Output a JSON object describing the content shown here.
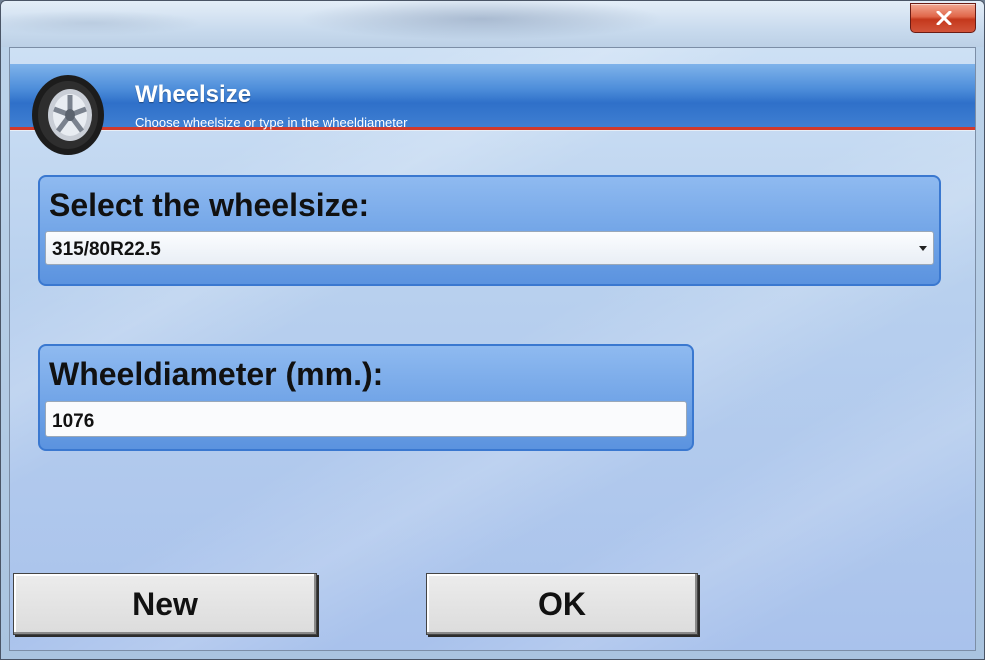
{
  "window": {
    "close_label": "x"
  },
  "header": {
    "title": "Wheelsize",
    "subtitle": "Choose wheelsize or type in the wheeldiameter",
    "icon": "tire-icon",
    "accent_color": "#d03a2c",
    "band_color": "#2f70c9"
  },
  "wheelsize": {
    "label": "Select the wheelsize:",
    "selected": "315/80R22.5"
  },
  "diameter": {
    "label": "Wheeldiameter (mm.):",
    "value": "1076"
  },
  "buttons": {
    "new_label": "New",
    "ok_label": "OK"
  }
}
